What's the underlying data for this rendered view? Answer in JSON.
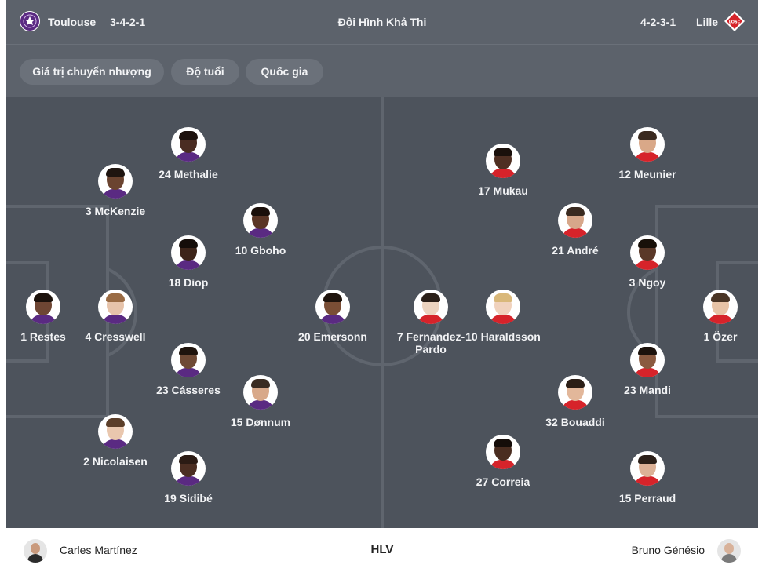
{
  "header": {
    "home_team": "Toulouse",
    "home_formation": "3-4-2-1",
    "title": "Đội Hình Khả Thi",
    "away_formation": "4-2-3-1",
    "away_team": "Lille",
    "away_logo_text": "LOSC"
  },
  "filters": [
    "Giá trị chuyển nhượng",
    "Độ tuổi",
    "Quốc gia"
  ],
  "home_players": [
    {
      "label": "24 Methalie"
    },
    {
      "label": "3 McKenzie"
    },
    {
      "label": "10 Gboho"
    },
    {
      "label": "18 Diop"
    },
    {
      "label": "1 Restes"
    },
    {
      "label": "4 Cresswell"
    },
    {
      "label": "20 Emersonn"
    },
    {
      "label": "23 Cásseres"
    },
    {
      "label": "15 Dønnum"
    },
    {
      "label": "2 Nicolaisen"
    },
    {
      "label": "19 Sidibé"
    }
  ],
  "away_players": [
    {
      "label": "12 Meunier"
    },
    {
      "label": "17 Mukau"
    },
    {
      "label": "21 André"
    },
    {
      "label": "3 Ngoy"
    },
    {
      "label": "7 Fernandez-Pardo"
    },
    {
      "label": "10 Haraldsson"
    },
    {
      "label": "1 Özer"
    },
    {
      "label": "23 Mandi"
    },
    {
      "label": "32 Bouaddi"
    },
    {
      "label": "27 Correia"
    },
    {
      "label": "15 Perraud"
    }
  ],
  "footer": {
    "home_coach": "Carles Martínez",
    "label": "HLV",
    "away_coach": "Bruno Génésio"
  },
  "colors": {
    "panel": "#4d535c",
    "header": "#5c626b",
    "pill": "#6b717a",
    "pitch_lines": "#5f656e",
    "text": "#f2f3f5",
    "toulouse": "#5a2a82",
    "lille": "#d6232a"
  }
}
